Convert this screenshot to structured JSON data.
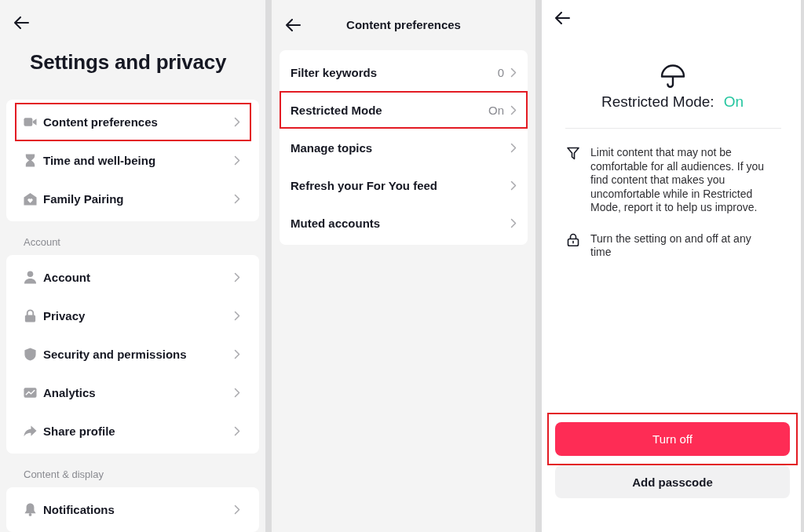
{
  "settings_screen": {
    "title": "Settings and privacy",
    "groups": [
      {
        "items": [
          {
            "label": "Content preferences",
            "highlighted": true
          },
          {
            "label": "Time and well-being",
            "highlighted": false
          },
          {
            "label": "Family Pairing",
            "highlighted": false
          }
        ]
      },
      {
        "heading": "Account",
        "items": [
          {
            "label": "Account",
            "highlighted": false
          },
          {
            "label": "Privacy",
            "highlighted": false
          },
          {
            "label": "Security and permissions",
            "highlighted": false
          },
          {
            "label": "Analytics",
            "highlighted": false
          },
          {
            "label": "Share profile",
            "highlighted": false
          }
        ]
      },
      {
        "heading": "Content & display",
        "items": [
          {
            "label": "Notifications",
            "highlighted": false
          }
        ]
      }
    ]
  },
  "content_preferences_screen": {
    "title": "Content preferences",
    "items": [
      {
        "label": "Filter keywords",
        "value": "0",
        "highlighted": false
      },
      {
        "label": "Restricted Mode",
        "value": "On",
        "highlighted": true
      },
      {
        "label": "Manage topics",
        "highlighted": false
      },
      {
        "label": "Refresh your For You feed",
        "highlighted": false
      },
      {
        "label": "Muted accounts",
        "highlighted": false
      }
    ]
  },
  "restricted_mode_screen": {
    "heading": "Restricted Mode:",
    "status": {
      "text": "On",
      "on": true
    },
    "notes": [
      "Limit content that may not be comfortable for all audiences. If you find content that makes you uncomfortable while in Restricted Mode, report it to help us improve.",
      "Turn the setting on and off at any time"
    ],
    "buttons": [
      {
        "label": "Turn off",
        "kind": "primary",
        "highlighted": true
      },
      {
        "label": "Add passcode",
        "kind": "secondary",
        "highlighted": false
      }
    ]
  }
}
